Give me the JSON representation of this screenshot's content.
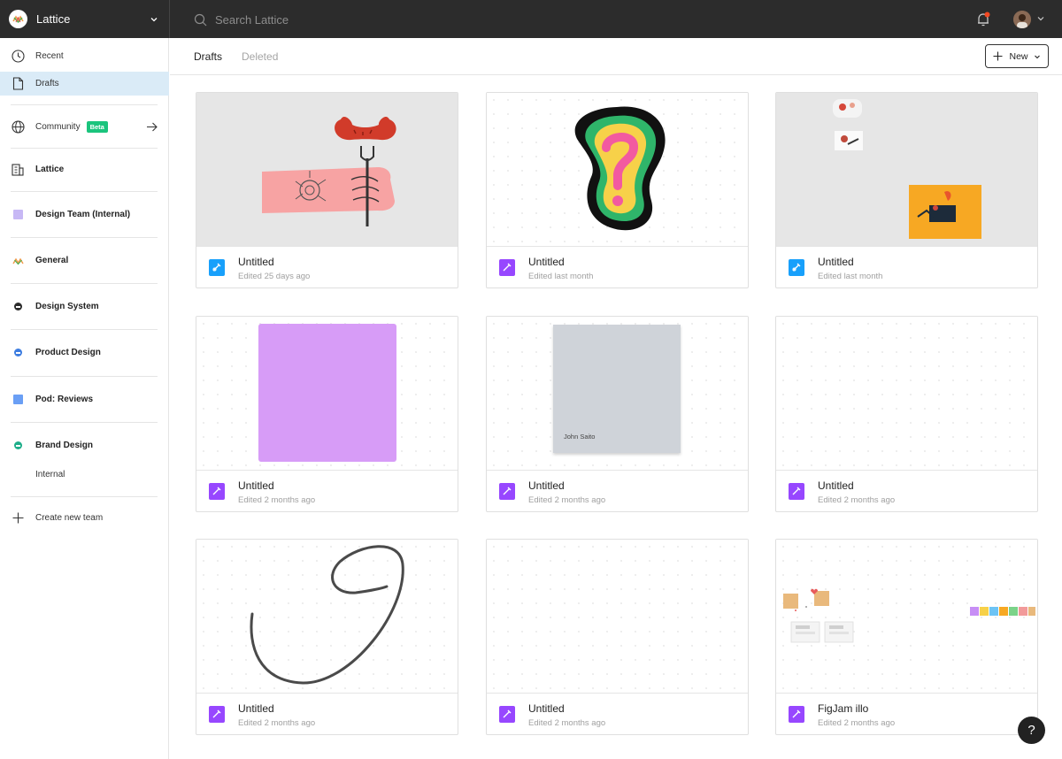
{
  "org": {
    "name": "Lattice"
  },
  "search": {
    "placeholder": "Search Lattice"
  },
  "colors": {
    "accent": "#18a0fb",
    "figjam": "#9747ff",
    "active_nav": "#daebf7",
    "beta": "#1bc47d",
    "notification": "#f24822"
  },
  "sidebar": {
    "recent": "Recent",
    "drafts": "Drafts",
    "community": "Community",
    "community_badge": "Beta",
    "teams": [
      {
        "label": "Lattice",
        "icon": "building-icon"
      },
      {
        "label": "Design Team (Internal)",
        "icon": "lavender-square",
        "color": "#c7b8f5"
      },
      {
        "label": "General",
        "icon": "lattice-logo"
      },
      {
        "label": "Design System",
        "icon": "dark-dot",
        "color": "#2c2c2c"
      },
      {
        "label": "Product Design",
        "icon": "blue-dot",
        "color": "#3d7de0"
      },
      {
        "label": "Pod: Reviews",
        "icon": "blue-square",
        "color": "#6a9ff5"
      },
      {
        "label": "Brand Design",
        "icon": "teal-dot",
        "color": "#1eae8a"
      }
    ],
    "internal": "Internal",
    "create_team": "Create new team"
  },
  "tabs": {
    "drafts": "Drafts",
    "deleted": "Deleted"
  },
  "new_button": "New",
  "files": [
    {
      "title": "Untitled",
      "edited": "Edited 25 days ago",
      "type": "design"
    },
    {
      "title": "Untitled",
      "edited": "Edited last month",
      "type": "figjam"
    },
    {
      "title": "Untitled",
      "edited": "Edited last month",
      "type": "design"
    },
    {
      "title": "Untitled",
      "edited": "Edited 2 months ago",
      "type": "figjam"
    },
    {
      "title": "Untitled",
      "edited": "Edited 2 months ago",
      "type": "figjam",
      "thumb_text": "John Saito"
    },
    {
      "title": "Untitled",
      "edited": "Edited 2 months ago",
      "type": "figjam"
    },
    {
      "title": "Untitled",
      "edited": "Edited 2 months ago",
      "type": "figjam"
    },
    {
      "title": "Untitled",
      "edited": "Edited 2 months ago",
      "type": "figjam"
    },
    {
      "title": "FigJam illo",
      "edited": "Edited 2 months ago",
      "type": "figjam"
    }
  ],
  "help": "?"
}
